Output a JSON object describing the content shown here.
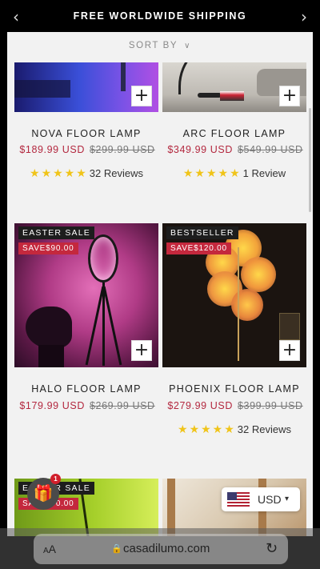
{
  "announcement": {
    "text": "FREE WORLDWIDE SHIPPING",
    "prev_icon": "‹",
    "next_icon": "›"
  },
  "sort": {
    "label": "SORT BY",
    "chevron": "∨"
  },
  "products": [
    {
      "title": "NOVA FLOOR LAMP",
      "price": "$189.99 USD",
      "compare_price": "$299.99 USD",
      "stars": "★★★★★",
      "reviews": "32 Reviews"
    },
    {
      "title": "ARC FLOOR LAMP",
      "price": "$349.99 USD",
      "compare_price": "$549.99 USD",
      "stars": "★★★★★",
      "reviews": "1 Review"
    },
    {
      "title": "HALO FLOOR LAMP",
      "price": "$179.99 USD",
      "compare_price": "$269.99 USD",
      "badge": "EASTER SALE",
      "save": "SAVE$90.00"
    },
    {
      "title": "PHOENIX FLOOR LAMP",
      "price": "$279.99 USD",
      "compare_price": "$399.99 USD",
      "badge": "BESTSELLER",
      "save": "SAVE$120.00",
      "stars": "★★★★★",
      "reviews": "32 Reviews"
    },
    {
      "badge": "EASTER SALE",
      "save": "SAVE$90.00"
    }
  ],
  "add_icon": "+",
  "gift": {
    "icon": "🎁",
    "count": "1"
  },
  "currency": {
    "code": "USD",
    "caret": "▾"
  },
  "browser": {
    "aa_small": "A",
    "aa_large": "A",
    "lock_icon": "🔒",
    "url": "casadilumo.com",
    "reload_icon": "↻"
  },
  "colors": {
    "sale_red": "#b3283f",
    "save_badge": "#c4283d",
    "star": "#f0c419"
  }
}
